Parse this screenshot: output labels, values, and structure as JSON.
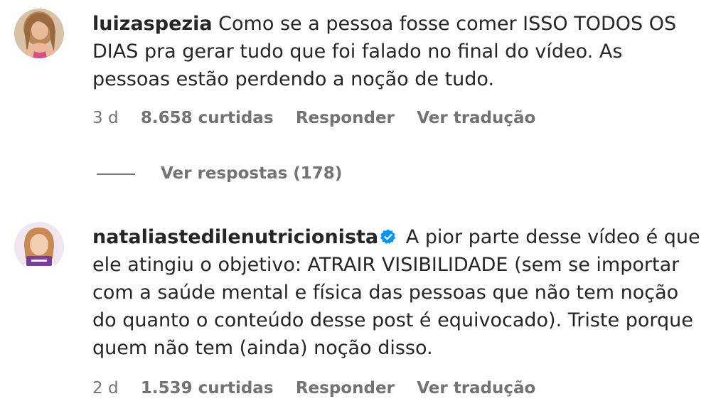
{
  "comments": [
    {
      "username": "luizaspezia",
      "text": "Como se a pessoa fosse comer ISSO TODOS OS DIAS pra gerar tudo que foi falado no final do vídeo. As pessoas estão perdendo a noção de tudo.",
      "time": "3 d",
      "likes": "8.658 curtidas",
      "reply_label": "Responder",
      "translate_label": "Ver tradução",
      "view_replies_label": "Ver respostas (178)",
      "verified": false
    },
    {
      "username": "nataliastedilenutricionista",
      "text": "A pior parte desse vídeo é que ele atingiu o objetivo: ATRAIR VISIBILIDADE (sem se importar com a saúde mental e física das pessoas que não tem noção do quanto o conteúdo desse post é equivocado). Triste porque quem não tem (ainda) noção disso.",
      "time": "2 d",
      "likes": "1.539 curtidas",
      "reply_label": "Responder",
      "translate_label": "Ver tradução",
      "verified": true
    }
  ],
  "colors": {
    "text": "#262626",
    "secondary": "#737373",
    "verified_badge": "#0095f6"
  },
  "icons": {
    "verified": "verified-badge-icon"
  }
}
